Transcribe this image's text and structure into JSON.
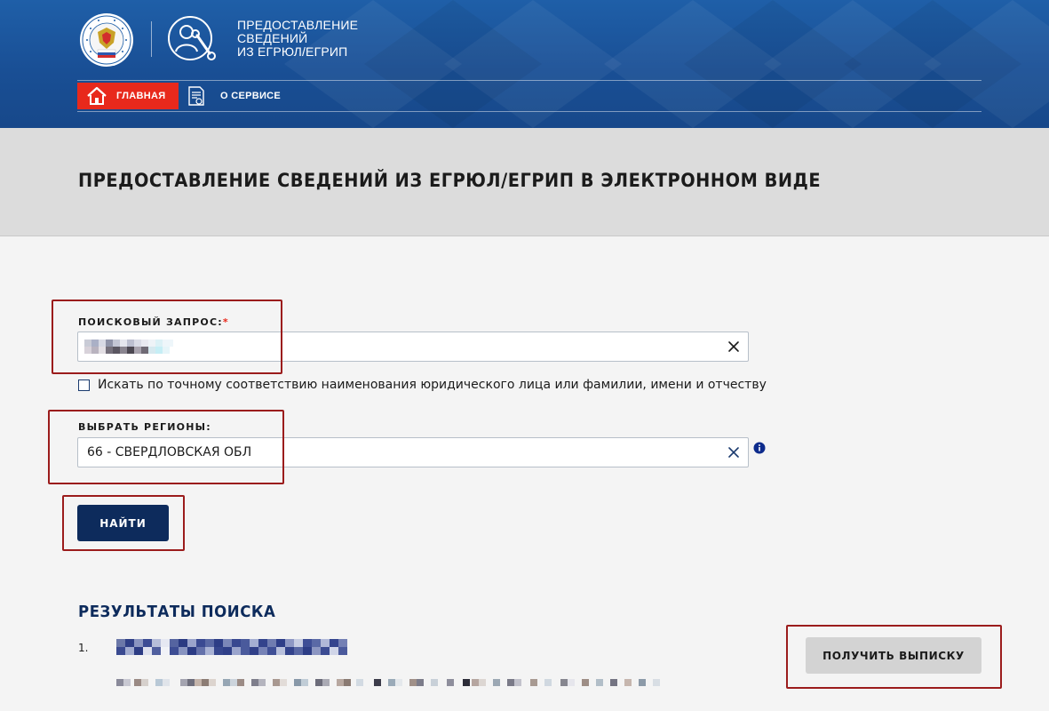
{
  "header": {
    "service_title_lines": [
      "ПРЕДОСТАВЛЕНИЕ",
      "СВЕДЕНИЙ",
      "ИЗ ЕГРЮЛ/ЕГРИП"
    ],
    "nav": {
      "home_label": "ГЛАВНАЯ",
      "about_label": "О СЕРВИСЕ"
    }
  },
  "page_title": "ПРЕДОСТАВЛЕНИЕ СВЕДЕНИЙ ИЗ ЕГРЮЛ/ЕГРИП В ЭЛЕКТРОННОМ ВИДЕ",
  "form": {
    "query_label": "ПОИСКОВЫЙ ЗАПРОС:",
    "query_required_mark": "*",
    "exact_match_label": "Искать по точному соответствию наименования юридического лица или фамилии, имени и отчеству",
    "exact_match_checked": false,
    "region_label": "ВЫБРАТЬ РЕГИОНЫ:",
    "region_value": "66 - СВЕРДЛОВСКАЯ ОБЛ",
    "find_button": "НАЙТИ"
  },
  "results": {
    "title": "РЕЗУЛЬТАТЫ ПОИСКА",
    "items": [
      {
        "index": "1.",
        "action_label": "ПОЛУЧИТЬ ВЫПИСКУ"
      }
    ]
  },
  "colors": {
    "header_blue": "#1f5fa8",
    "nav_home_red": "#e8291c",
    "button_navy": "#0d2b5c",
    "annotation_red": "#9b1c1c"
  },
  "icons": {
    "fns_logo": "fns-emblem-icon",
    "service_logo": "service-worker-icon",
    "home": "home-icon",
    "about": "document-icon",
    "clear": "close-icon",
    "info": "info-icon"
  }
}
